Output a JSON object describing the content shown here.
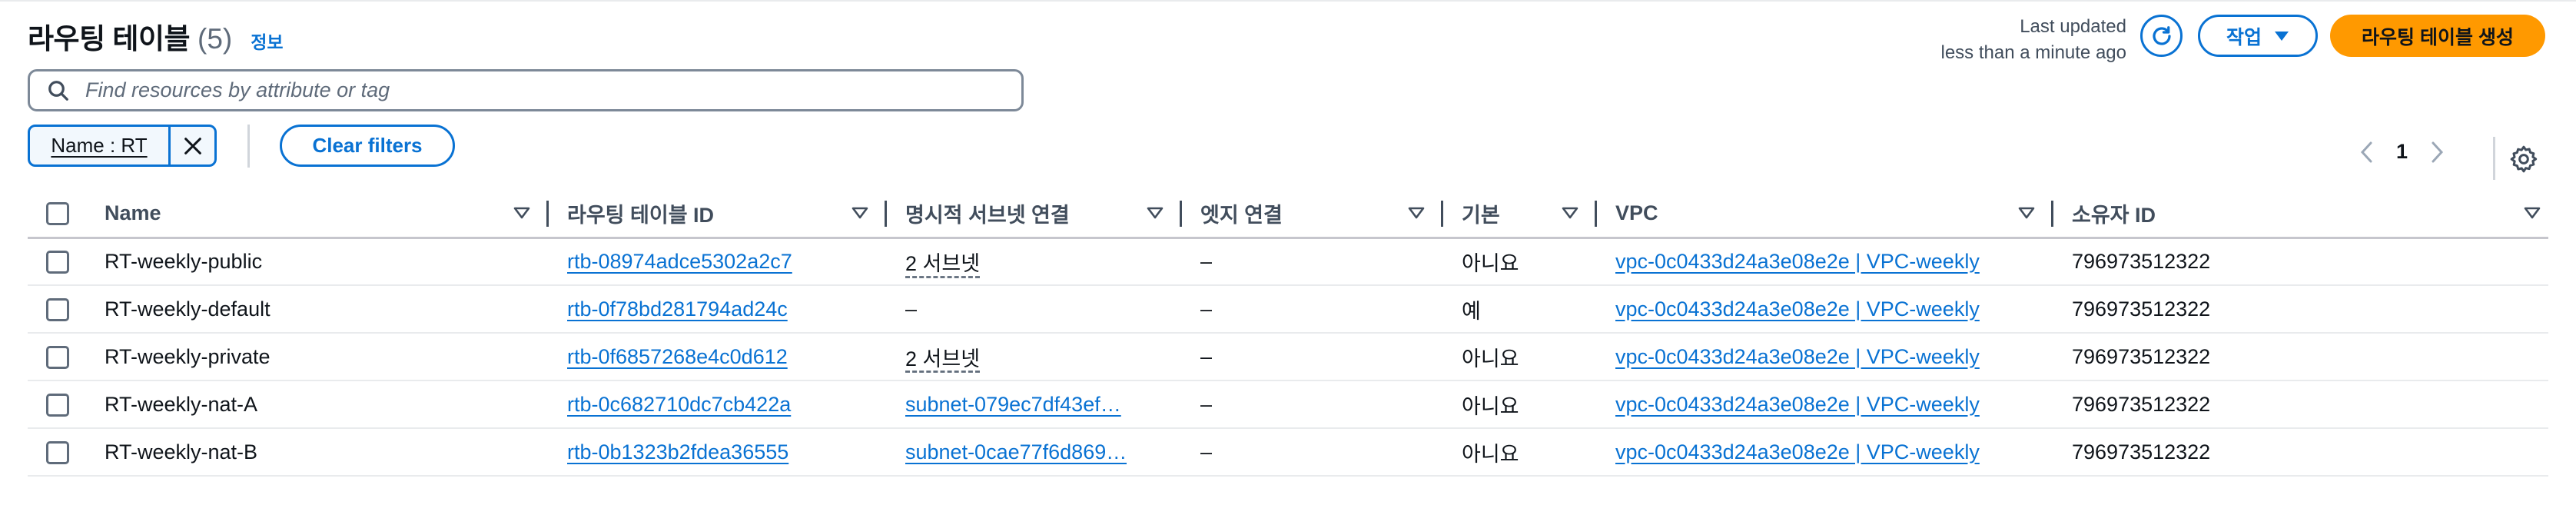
{
  "header": {
    "title": "라우팅 테이블",
    "count": "(5)",
    "info_link": "정보",
    "last_updated_label": "Last updated",
    "last_updated_value": "less than a minute ago",
    "action_button": "작업",
    "create_button": "라우팅 테이블 생성"
  },
  "search": {
    "placeholder": "Find resources by attribute or tag",
    "value": ""
  },
  "filters": {
    "token_label": "Name : RT",
    "clear_button": "Clear filters"
  },
  "pagination": {
    "current_page": "1"
  },
  "table": {
    "columns": [
      "Name",
      "라우팅 테이블 ID",
      "명시적 서브넷 연결",
      "엣지 연결",
      "기본",
      "VPC",
      "소유자 ID"
    ],
    "rows": [
      {
        "name": "RT-weekly-public",
        "id": "rtb-08974adce5302a2c7",
        "subnets": "2 서브넷",
        "edge": "–",
        "main": "아니요",
        "vpc": "vpc-0c0433d24a3e08e2e | VPC-weekly",
        "owner": "796973512322"
      },
      {
        "name": "RT-weekly-default",
        "id": "rtb-0f78bd281794ad24c",
        "subnets": "–",
        "edge": "–",
        "main": "예",
        "vpc": "vpc-0c0433d24a3e08e2e | VPC-weekly",
        "owner": "796973512322"
      },
      {
        "name": "RT-weekly-private",
        "id": "rtb-0f6857268e4c0d612",
        "subnets": "2 서브넷",
        "edge": "–",
        "main": "아니요",
        "vpc": "vpc-0c0433d24a3e08e2e | VPC-weekly",
        "owner": "796973512322"
      },
      {
        "name": "RT-weekly-nat-A",
        "id": "rtb-0c682710dc7cb422a",
        "subnets": "subnet-079ec7df43ef…",
        "edge": "–",
        "main": "아니요",
        "vpc": "vpc-0c0433d24a3e08e2e | VPC-weekly",
        "owner": "796973512322"
      },
      {
        "name": "RT-weekly-nat-B",
        "id": "rtb-0b1323b2fdea36555",
        "subnets": "subnet-0cae77f6d869…",
        "edge": "–",
        "main": "아니요",
        "vpc": "vpc-0c0433d24a3e08e2e | VPC-weekly",
        "owner": "796973512322"
      }
    ]
  },
  "colors": {
    "link": "#0972d3",
    "primary_button": "#ff9900",
    "text": "#0f141a"
  },
  "icons": [
    "refresh-icon",
    "caret-down-icon",
    "search-icon",
    "close-icon",
    "chevron-left-icon",
    "chevron-right-icon",
    "gear-icon",
    "sort-icon"
  ]
}
